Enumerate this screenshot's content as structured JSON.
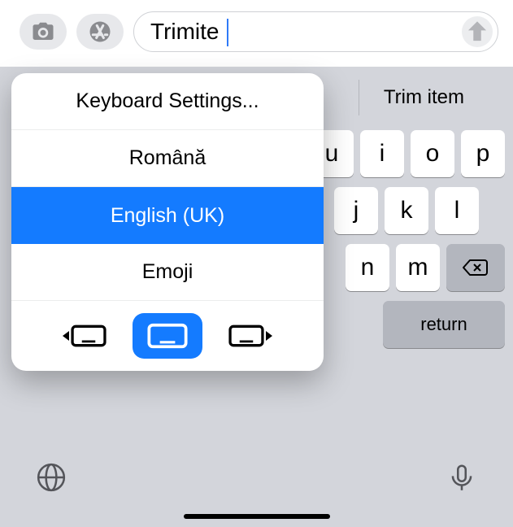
{
  "input": {
    "value": "Trimite",
    "placeholder": ""
  },
  "suggestion": "Trim item",
  "keys_row1": [
    "u",
    "i",
    "o",
    "p"
  ],
  "keys_row2": [
    "j",
    "k",
    "l"
  ],
  "keys_row3": [
    "n",
    "m"
  ],
  "return_label": "return",
  "popup": {
    "settings": "Keyboard Settings...",
    "lang1": "Română",
    "lang2": "English (UK)",
    "emoji": "Emoji"
  }
}
